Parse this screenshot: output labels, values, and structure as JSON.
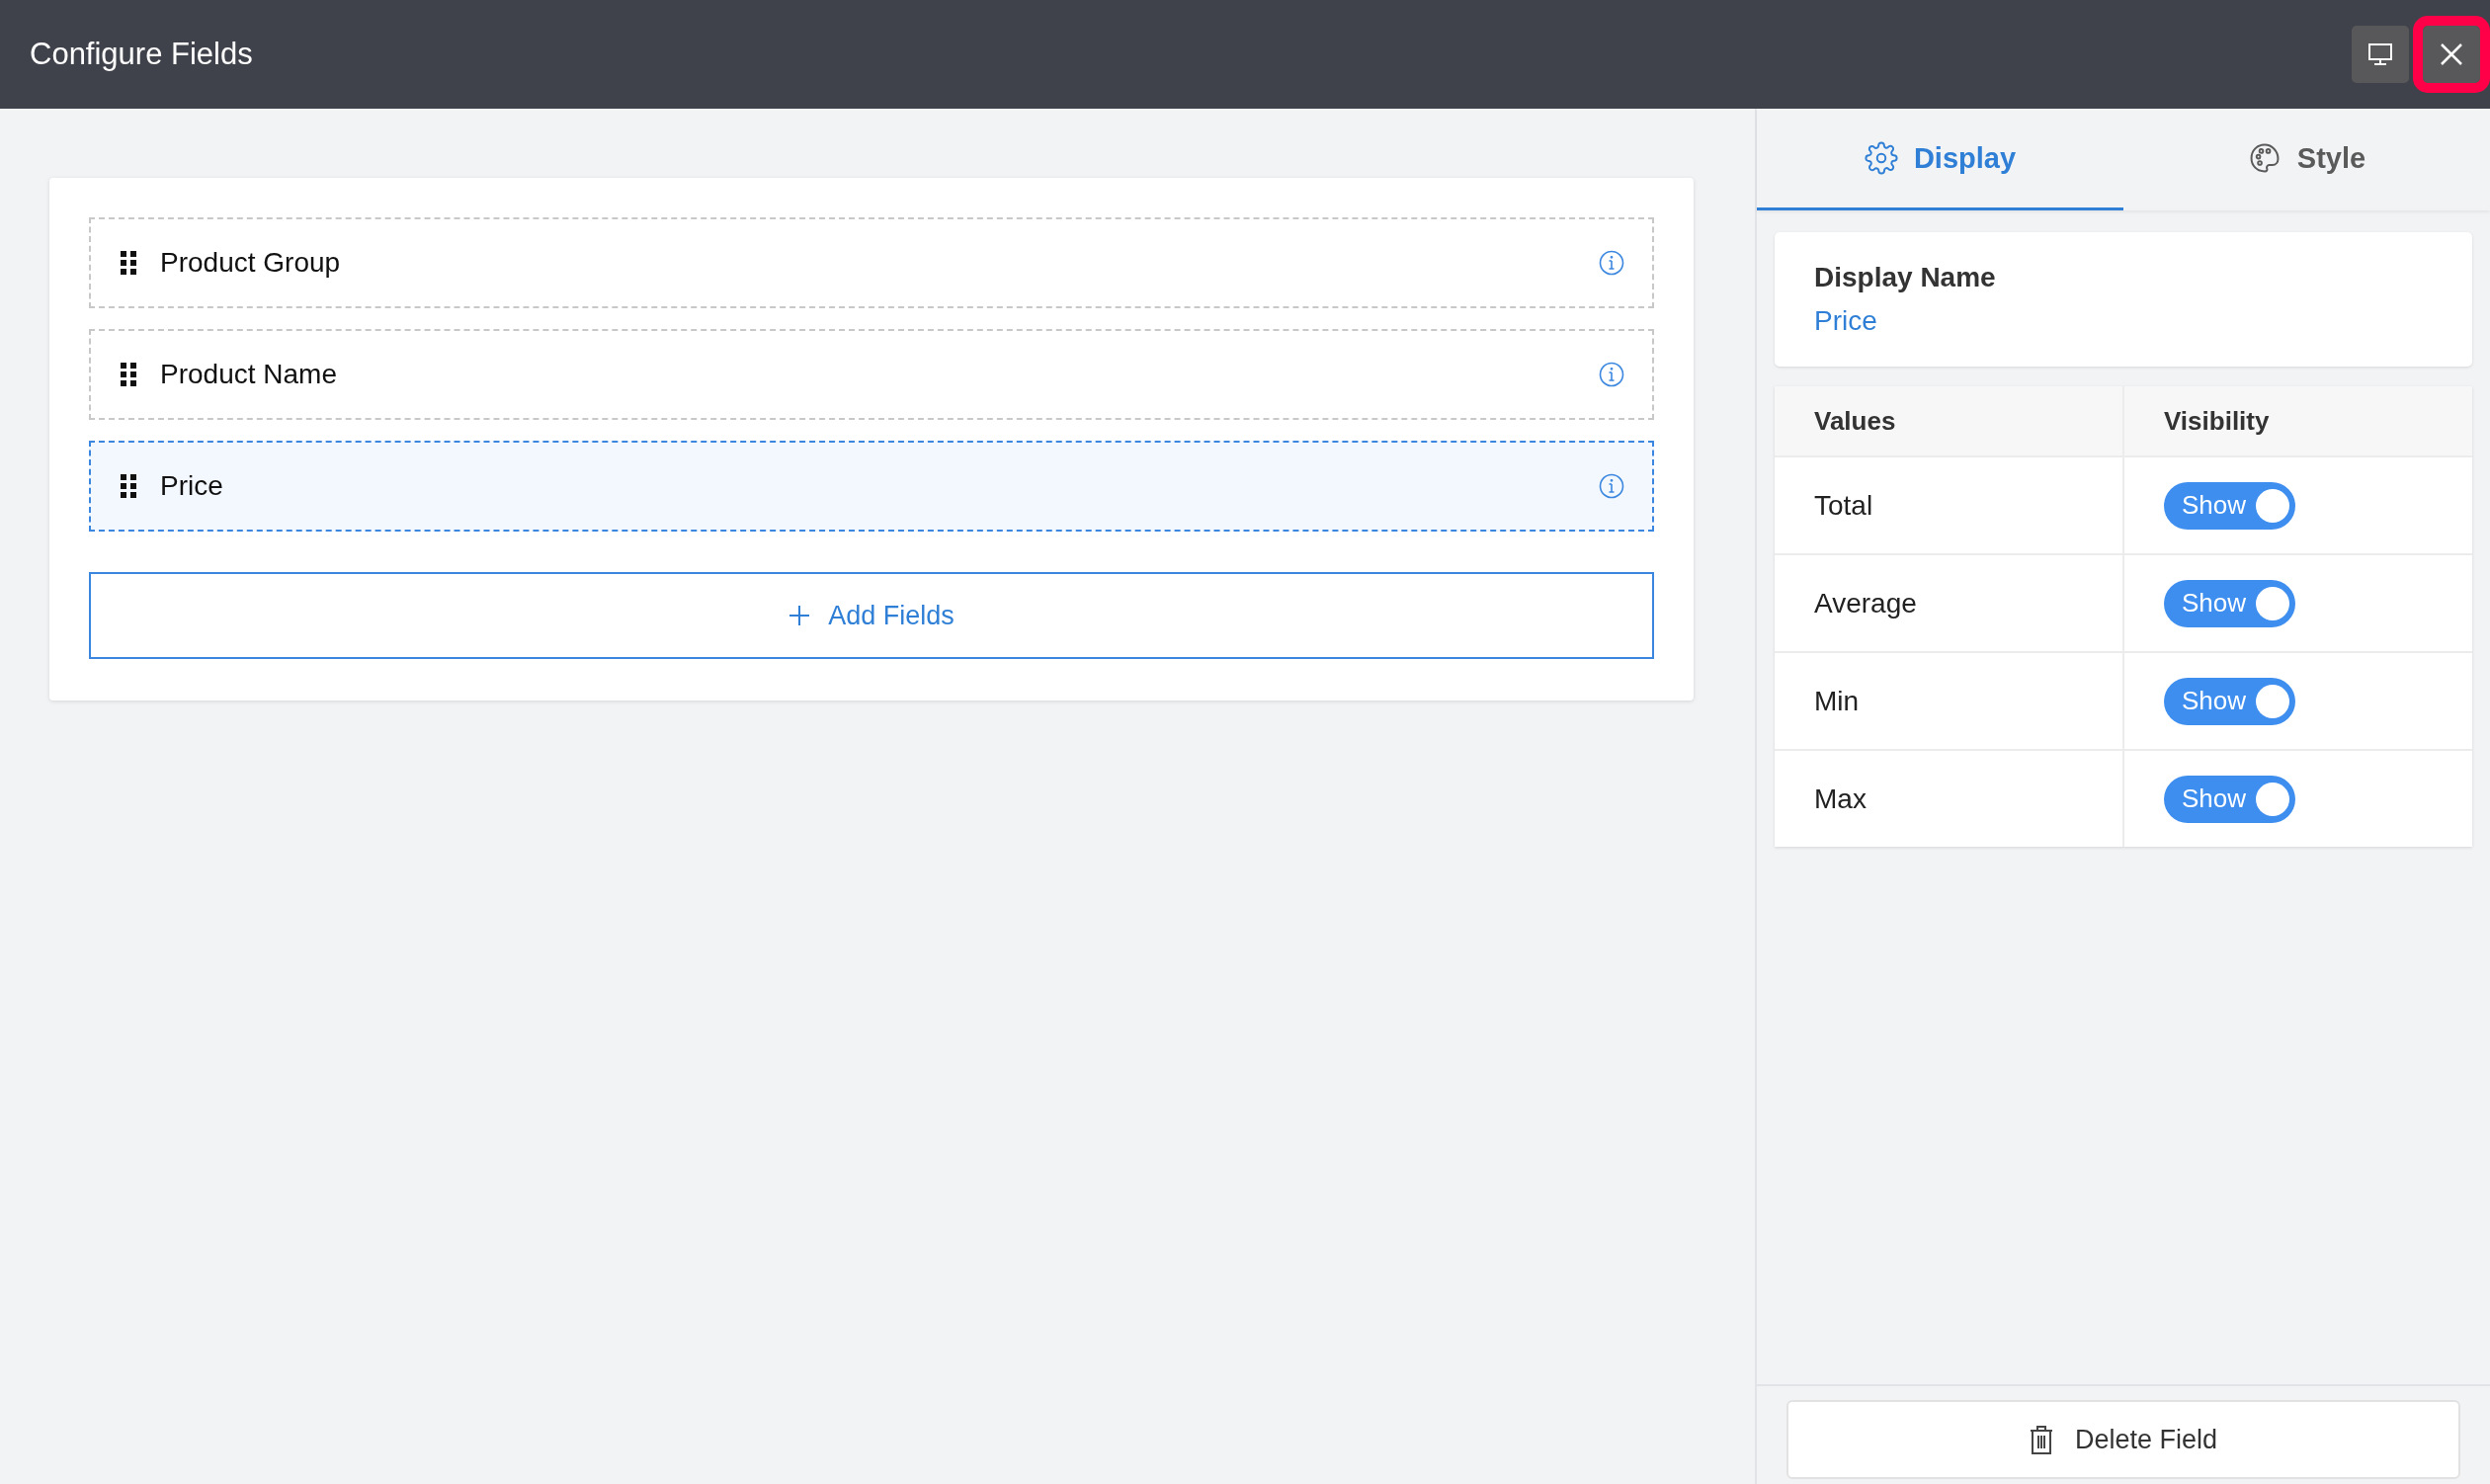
{
  "window": {
    "title": "Configure Fields",
    "buttons": [
      {
        "kind": "monitor",
        "highlighted": false
      },
      {
        "kind": "close",
        "highlighted": true
      }
    ]
  },
  "fields": [
    {
      "label": "Product Group",
      "selected": false
    },
    {
      "label": "Product Name",
      "selected": false
    },
    {
      "label": "Price",
      "selected": true
    }
  ],
  "add_button": "Add Fields",
  "tabs": [
    {
      "label": "Display",
      "kind": "gear",
      "selected": true
    },
    {
      "label": "Style",
      "kind": "palette",
      "selected": false
    }
  ],
  "display_name": {
    "label": "Display Name",
    "value": "Price"
  },
  "table": {
    "columns": [
      "Values",
      "Visibility"
    ],
    "rows": [
      {
        "value": "Total",
        "toggle": {
          "label": "Show",
          "on": true
        }
      },
      {
        "value": "Average",
        "toggle": {
          "label": "Show",
          "on": true
        }
      },
      {
        "value": "Min",
        "toggle": {
          "label": "Show",
          "on": true
        }
      },
      {
        "value": "Max",
        "toggle": {
          "label": "Show",
          "on": true
        }
      }
    ]
  },
  "delete_button": "Delete Field"
}
